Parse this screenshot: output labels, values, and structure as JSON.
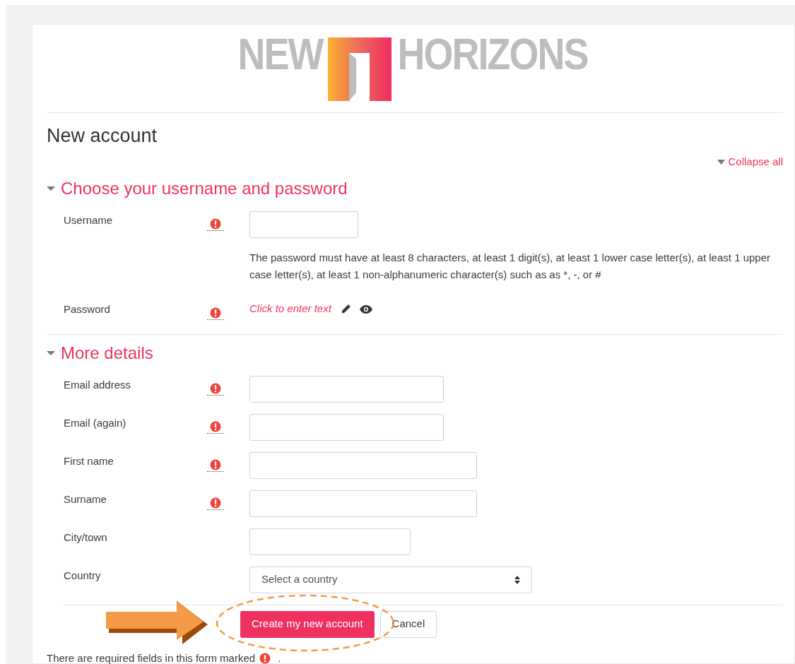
{
  "logo": {
    "word_left": "NEW",
    "word_right": "HORIZONS"
  },
  "page_title": "New account",
  "collapse_all": "Collapse all",
  "sections": [
    {
      "title": "Choose your username and password",
      "expanded": true,
      "fields": [
        {
          "kind": "text",
          "label": "Username",
          "required": true
        },
        {
          "kind": "help",
          "text": "The password must have at least 8 characters, at least 1 digit(s), at least 1 lower case letter(s), at least 1 upper case letter(s), at least 1 non-alphanumeric character(s) such as as *, -, or #"
        },
        {
          "kind": "inline_edit",
          "label": "Password",
          "required": true,
          "placeholder": "Click to enter text"
        }
      ]
    },
    {
      "title": "More details",
      "expanded": true,
      "fields": [
        {
          "kind": "text",
          "label": "Email address",
          "required": true
        },
        {
          "kind": "text",
          "label": "Email (again)",
          "required": true
        },
        {
          "kind": "text",
          "label": "First name",
          "required": true
        },
        {
          "kind": "text",
          "label": "Surname",
          "required": true
        },
        {
          "kind": "text",
          "label": "City/town",
          "required": false
        },
        {
          "kind": "select",
          "label": "Country",
          "required": false,
          "value": "Select a country"
        }
      ]
    }
  ],
  "buttons": [
    {
      "kind": "primary",
      "label": "Create my new account"
    },
    {
      "kind": "secondary",
      "label": "Cancel"
    }
  ],
  "footer_note": "There are required fields in this form marked",
  "footer_end": "."
}
